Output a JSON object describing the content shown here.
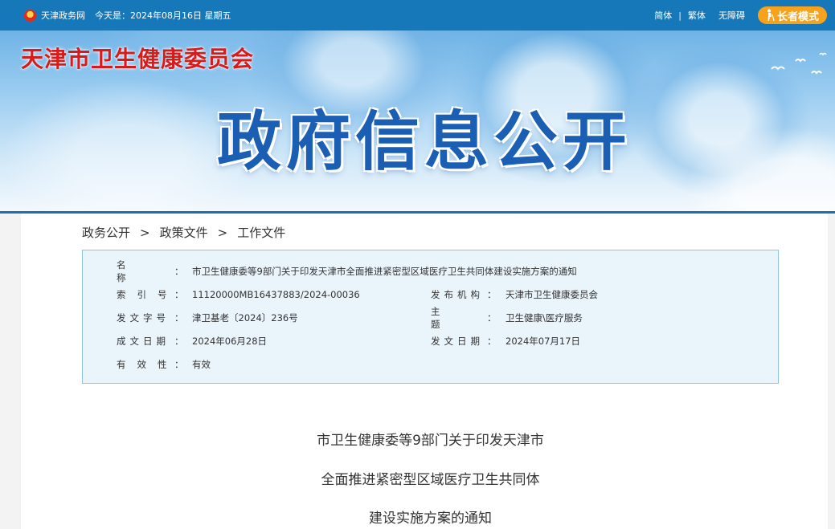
{
  "topbar": {
    "site": "天津政务网",
    "date_text": "今天是：2024年08月16日 星期五",
    "lang_simplified": "简体",
    "separator": "|",
    "lang_traditional": "繁体",
    "accessibility": "无障碍",
    "elder_mode": "长者模式"
  },
  "banner": {
    "org_name": "天津市卫生健康委员会",
    "title": "政府信息公开"
  },
  "breadcrumb": {
    "items": [
      "政务公开",
      "政策文件",
      "工作文件"
    ],
    "separator": ">"
  },
  "meta": {
    "name_label": "名称",
    "name_value": "市卫生健康委等9部门关于印发天津市全面推进紧密型区域医疗卫生共同体建设实施方案的通知",
    "index_label": "索引号",
    "index_value": "11120000MB16437883/2024-00036",
    "publisher_label": "发布机构",
    "publisher_value": "天津市卫生健康委员会",
    "docno_label": "发文字号",
    "docno_value": "津卫基老〔2024〕236号",
    "topic_label": "主题",
    "topic_value": "卫生健康\\医疗服务",
    "written_label": "成文日期",
    "written_value": "2024年06月28日",
    "issued_label": "发文日期",
    "issued_value": "2024年07月17日",
    "validity_label": "有效性",
    "validity_value": "有效",
    "colon": "："
  },
  "document": {
    "title_line1": "市卫生健康委等9部门关于印发天津市",
    "title_line2": "全面推进紧密型区域医疗卫生共同体",
    "title_line3": "建设实施方案的通知"
  },
  "colors": {
    "topbar": "#1677b9",
    "org_red": "#d81a1a",
    "title_blue": "#1a5fb4",
    "elder_orange": "#f6a21c",
    "meta_bg": "#eaf4fb",
    "meta_border": "#8cc3e3"
  },
  "icons": {
    "emblem": "national-emblem-icon",
    "elder": "elder-person-icon"
  }
}
